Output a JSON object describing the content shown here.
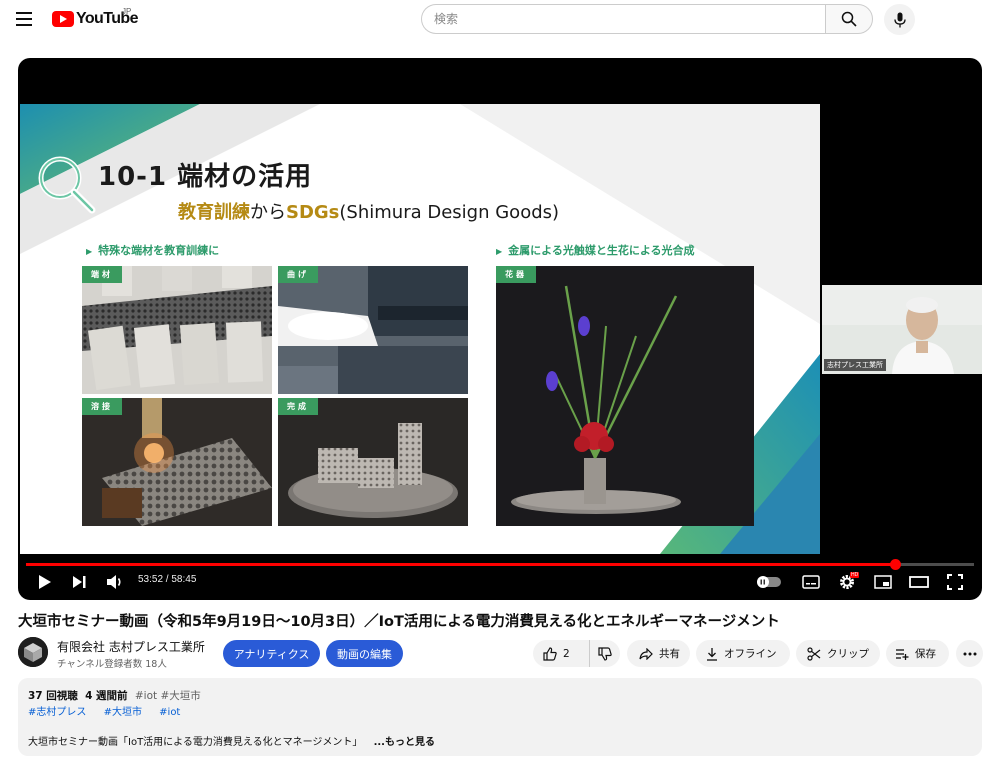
{
  "header": {
    "logo_text": "YouTube",
    "region": "JP",
    "search_placeholder": "検索"
  },
  "slide": {
    "title": "10-1 端材の活用",
    "subtitle_a": "教育訓練",
    "subtitle_b": "から",
    "subtitle_c": "SDGs",
    "subtitle_d": "(Shimura Design Goods)",
    "bullet_left": "特殊な端材を教育訓練に",
    "bullet_right": "金属による光触媒と生花による光合成",
    "labels": [
      "端材",
      "曲げ",
      "溶接",
      "完成",
      "花器"
    ],
    "webcam_name": "志村プレス工業所"
  },
  "player": {
    "time_current": "53:52",
    "time_total": "58:45",
    "time_display": "53:52 / 58:45",
    "progress_fraction": 0.917
  },
  "video": {
    "title": "大垣市セミナー動画（令和5年9月19日〜10月3日）／IoT活用による電力消費見える化とエネルギーマネージメント",
    "channel_name": "有限会社 志村プレス工業所",
    "subscribers": "チャンネル登録者数 18人",
    "analytics_label": "アナリティクス",
    "edit_label": "動画の編集",
    "like_count": "2",
    "share_label": "共有",
    "offline_label": "オフライン",
    "clip_label": "クリップ",
    "save_label": "保存"
  },
  "description": {
    "views": "37 回視聴",
    "age": "4 週間前",
    "inline_tags": "#iot #大垣市",
    "tags": [
      "#志村プレス",
      "#大垣市",
      "#iot"
    ],
    "text": "大垣市セミナー動画「IoT活用による電力消費見える化とマネージメント」",
    "more": "...もっと見る"
  },
  "colors": {
    "brand_red": "#ff0000",
    "accent_blue": "#2a5bd7",
    "slide_green": "#3a9b5f",
    "slide_gold": "#b58a14"
  }
}
